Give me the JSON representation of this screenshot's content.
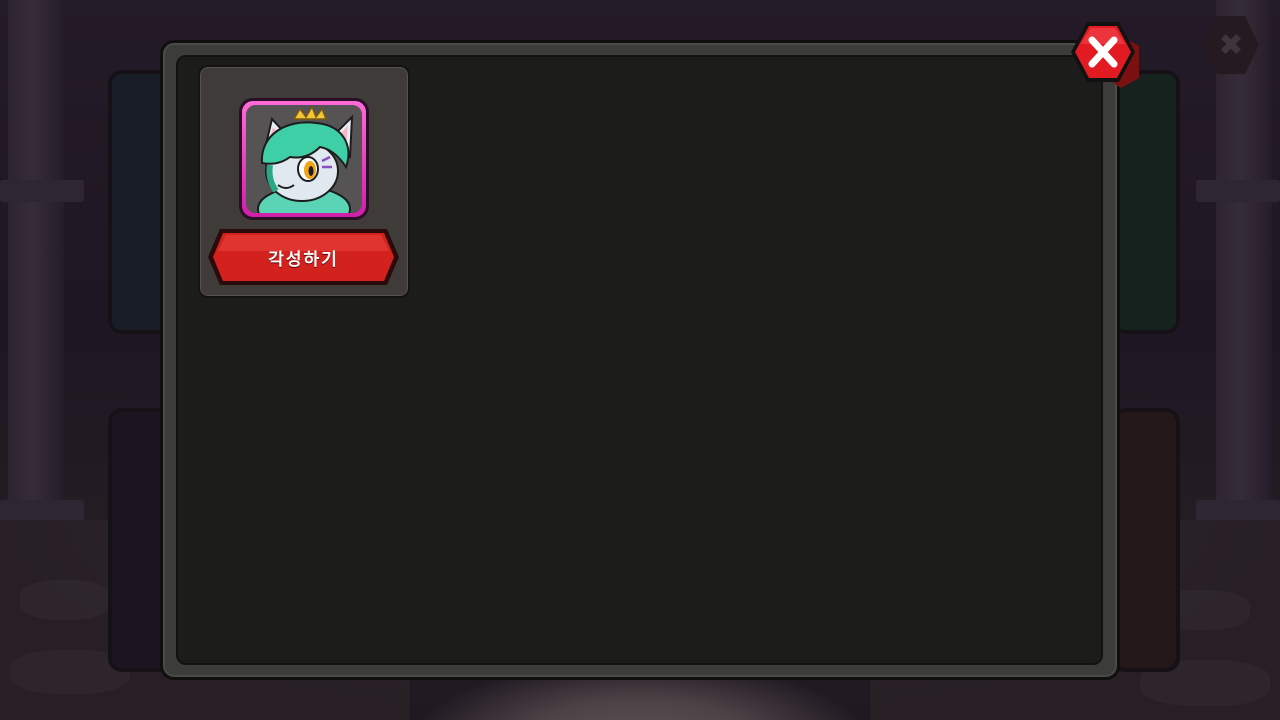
{
  "screen": "awaken-popup",
  "modal": {
    "close_icon": "close-x-icon",
    "cards": [
      {
        "portrait_icon": "green-haired-cat-hero-portrait",
        "frame_color": "#e83bc3",
        "action_label": "각성하기"
      }
    ]
  },
  "background": {
    "close_icon": "close-x-icon"
  },
  "colors": {
    "button_red": "#d0201f",
    "close_red": "#e21b22",
    "panel_dark": "#1c1c1b"
  }
}
